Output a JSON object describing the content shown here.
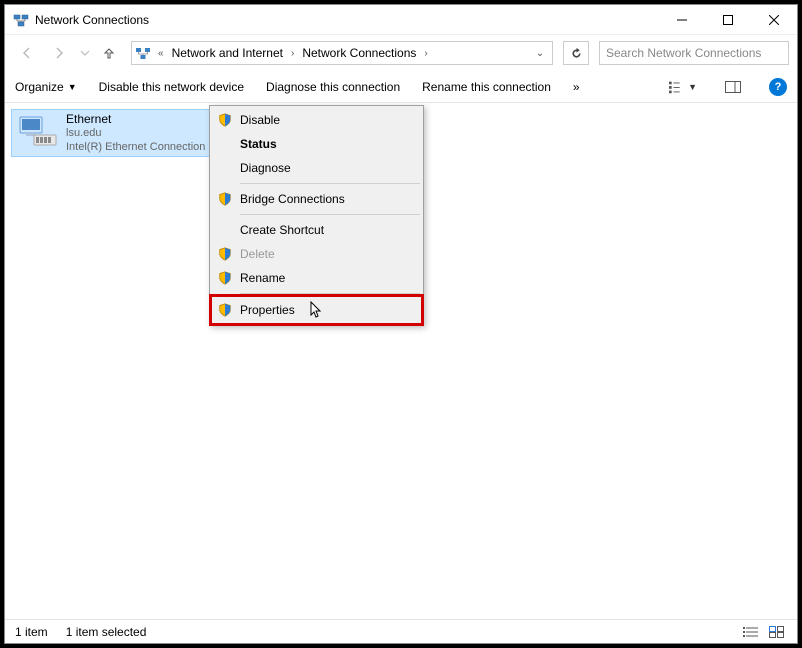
{
  "window_title": "Network Connections",
  "breadcrumb": {
    "prefix": "«",
    "segments": [
      "Network and Internet",
      "Network Connections"
    ]
  },
  "search": {
    "placeholder": "Search Network Connections"
  },
  "toolbar": {
    "organize": "Organize",
    "disable": "Disable this network device",
    "diagnose": "Diagnose this connection",
    "rename": "Rename this connection",
    "overflow": "»"
  },
  "adapter": {
    "name": "Ethernet",
    "network": "lsu.edu",
    "device": "Intel(R) Ethernet Connection"
  },
  "context_menu": {
    "disable": "Disable",
    "status": "Status",
    "diagnose": "Diagnose",
    "bridge": "Bridge Connections",
    "shortcut": "Create Shortcut",
    "delete": "Delete",
    "rename": "Rename",
    "properties": "Properties"
  },
  "statusbar": {
    "count": "1 item",
    "selected": "1 item selected"
  }
}
